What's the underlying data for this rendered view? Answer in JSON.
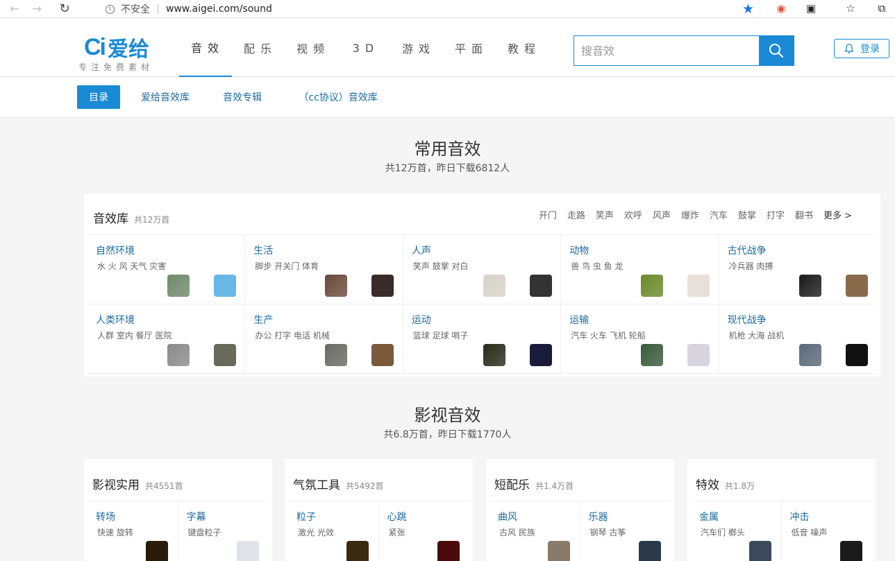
{
  "browser": {
    "back_icon": "arrow-left-icon",
    "security_label": "不安全",
    "url": "www.aigei.com/sound"
  },
  "site": {
    "logo_mark": "Ci",
    "logo_name": "爱给",
    "slogan": "专注免费素材",
    "nav": [
      {
        "label": "音效",
        "active": true
      },
      {
        "label": "配乐"
      },
      {
        "label": "视频"
      },
      {
        "label": "3D"
      },
      {
        "label": "游戏"
      },
      {
        "label": "平面"
      },
      {
        "label": "教程"
      }
    ],
    "search_placeholder": "搜音效",
    "login_label": "登录",
    "brand_color": "#1a8ad4"
  },
  "sub_nav": [
    {
      "label": "目录",
      "active": true
    },
    {
      "label": "爱给音效库"
    },
    {
      "label": "音效专辑"
    },
    {
      "label": "（cc协议）音效库"
    }
  ],
  "common": {
    "title": "常用音效",
    "subtitle": "共12万首，昨日下载6812人",
    "panel_title": "音效库",
    "panel_count": "共12万首",
    "quick_tags": [
      "开门",
      "走路",
      "笑声",
      "欢呼",
      "风声",
      "爆炸",
      "汽车",
      "鼓掌",
      "打字",
      "翻书"
    ],
    "more_label": "更多 >",
    "categories": [
      {
        "name": "自然环境",
        "tags": "水 火 风 天气 灾害",
        "thumbs": [
          "#6f8a6a",
          "#69b7e6"
        ]
      },
      {
        "name": "生活",
        "tags": "脚步 开关门 体育",
        "thumbs": [
          "#6a4a3a",
          "#3a2a28"
        ]
      },
      {
        "name": "人声",
        "tags": "笑声 鼓掌 对白",
        "thumbs": [
          "#d8d2c8",
          "#333333"
        ]
      },
      {
        "name": "动物",
        "tags": "兽 鸟 虫 鱼 龙",
        "thumbs": [
          "#6a8a2a",
          "#e8e0d8"
        ]
      },
      {
        "name": "古代战争",
        "tags": "冷兵器 肉搏",
        "thumbs": [
          "#1a1a1a",
          "#8a6a4a"
        ]
      },
      {
        "name": "人类环境",
        "tags": "人群 室内 餐厅 医院",
        "thumbs": [
          "#8a8a8a",
          "#6a6a5a"
        ]
      },
      {
        "name": "生产",
        "tags": "办公 打字 电话 机械",
        "thumbs": [
          "#6a6a62",
          "#7a5a3a"
        ]
      },
      {
        "name": "运动",
        "tags": "篮球 足球 哨子",
        "thumbs": [
          "#2a2a1a",
          "#1a1a3a"
        ]
      },
      {
        "name": "运输",
        "tags": "汽车 火车 飞机 轮船",
        "thumbs": [
          "#3a5a3a",
          "#d8d4e0"
        ]
      },
      {
        "name": "现代战争",
        "tags": "机枪 大海 战机",
        "thumbs": [
          "#5a6a7a",
          "#111111"
        ]
      }
    ]
  },
  "film": {
    "title": "影视音效",
    "subtitle": "共6.8万首，昨日下载1770人",
    "panels": [
      {
        "title": "影视实用",
        "count": "共4551首",
        "cells": [
          {
            "name": "转场",
            "tags": "快速 旋转",
            "thumb": "#2a1a0a"
          },
          {
            "name": "字幕",
            "tags": "键盘粒子",
            "thumb": "#e0e4e8"
          }
        ]
      },
      {
        "title": "气氛工具",
        "count": "共5492首",
        "cells": [
          {
            "name": "粒子",
            "tags": "激光 光效",
            "thumb": "#3a2a10"
          },
          {
            "name": "心跳",
            "tags": "紧张",
            "thumb": "#4a0a0a"
          }
        ]
      },
      {
        "title": "短配乐",
        "count": "共1.4万首",
        "cells": [
          {
            "name": "曲风",
            "tags": "古风 民族",
            "thumb": "#8a7a6a"
          },
          {
            "name": "乐器",
            "tags": "钢琴 古筝",
            "thumb": "#2a3a4a"
          }
        ]
      },
      {
        "title": "特效",
        "count": "共1.8万",
        "cells": [
          {
            "name": "金属",
            "tags": "汽车们 榔头",
            "thumb": "#3a4a5a"
          },
          {
            "name": "冲击",
            "tags": "低音 噪声",
            "thumb": "#1a1a1a"
          }
        ]
      }
    ]
  }
}
